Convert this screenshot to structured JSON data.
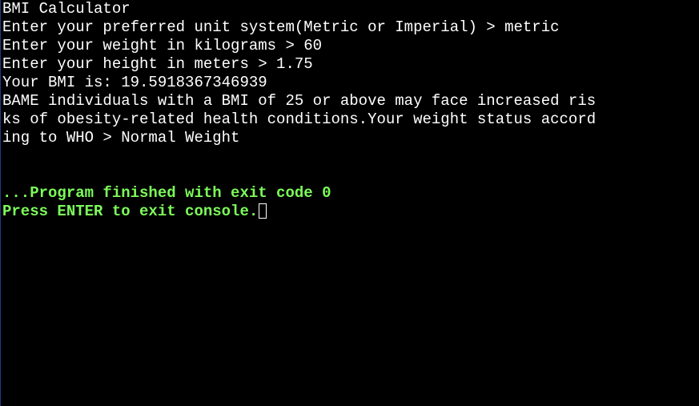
{
  "console": {
    "output_lines": [
      "BMI Calculator",
      "Enter your preferred unit system(Metric or Imperial) > metric",
      "Enter your weight in kilograms > 60",
      "Enter your height in meters > 1.75",
      "Your BMI is: 19.5918367346939",
      "BAME individuals with a BMI of 25 or above may face increased ris",
      "ks of obesity-related health conditions.Your weight status accord",
      "ing to WHO > Normal Weight"
    ],
    "finished_message": "...Program finished with exit code 0",
    "exit_prompt": "Press ENTER to exit console."
  },
  "colors": {
    "background": "#000000",
    "text": "#ffffff",
    "status_text": "#7cfc5a"
  }
}
